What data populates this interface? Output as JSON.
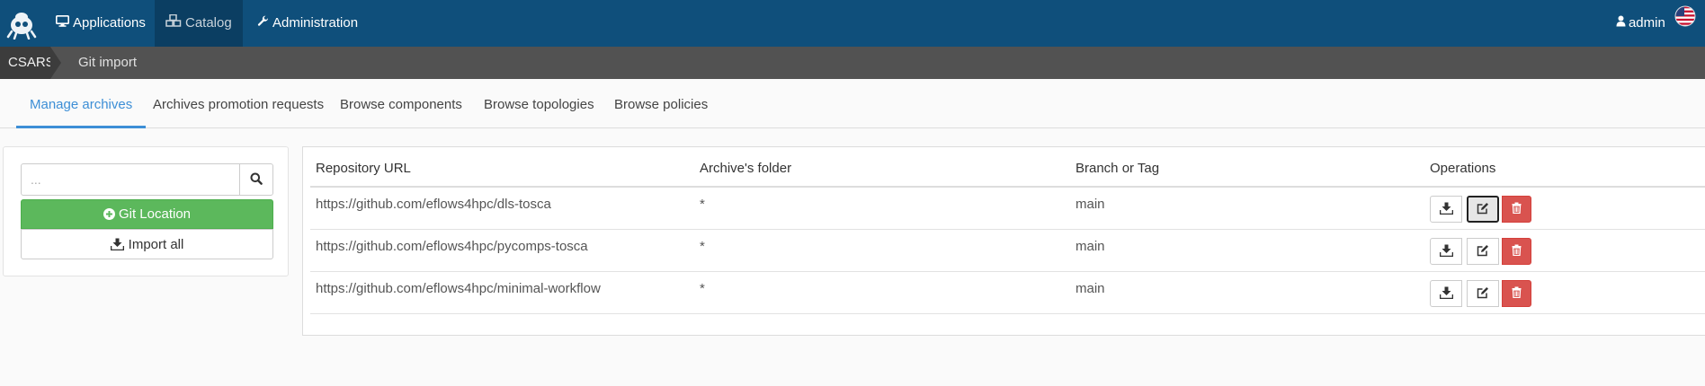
{
  "navbar": {
    "items": [
      {
        "label": "Applications",
        "icon": "desktop-icon",
        "active": false
      },
      {
        "label": "Catalog",
        "icon": "cubes-icon",
        "active": true
      },
      {
        "label": "Administration",
        "icon": "wrench-icon",
        "active": false
      }
    ],
    "user": {
      "label": "admin",
      "icon": "user-icon",
      "flag": "us-flag-icon"
    },
    "colors": {
      "background": "#0f4f7b",
      "active": "#0b3e62"
    }
  },
  "breadcrumb": {
    "items": [
      "CSARS",
      "Git import"
    ]
  },
  "tabs": [
    {
      "label": "Manage archives",
      "active": true
    },
    {
      "label": "Archives promotion requests",
      "active": false
    },
    {
      "label": "Browse components",
      "active": false
    },
    {
      "label": "Browse topologies",
      "active": false
    },
    {
      "label": "Browse policies",
      "active": false
    }
  ],
  "sidebar": {
    "search": {
      "placeholder": "...",
      "value": ""
    },
    "git_location_label": "Git Location",
    "import_all_label": "Import all",
    "colors": {
      "git_location": "#5cb85c"
    }
  },
  "table": {
    "columns": [
      "Repository URL",
      "Archive's folder",
      "Branch or Tag",
      "Operations"
    ],
    "rows": [
      {
        "url": "https://github.com/eflows4hpc/dls-tosca",
        "folder": "*",
        "branch": "main"
      },
      {
        "url": "https://github.com/eflows4hpc/pycomps-tosca",
        "folder": "*",
        "branch": "main"
      },
      {
        "url": "https://github.com/eflows4hpc/minimal-workflow",
        "folder": "*",
        "branch": "main"
      }
    ],
    "operations": {
      "download": "download-icon",
      "edit": "edit-icon",
      "delete": "trash-icon"
    },
    "colors": {
      "delete": "#d9534f"
    }
  }
}
